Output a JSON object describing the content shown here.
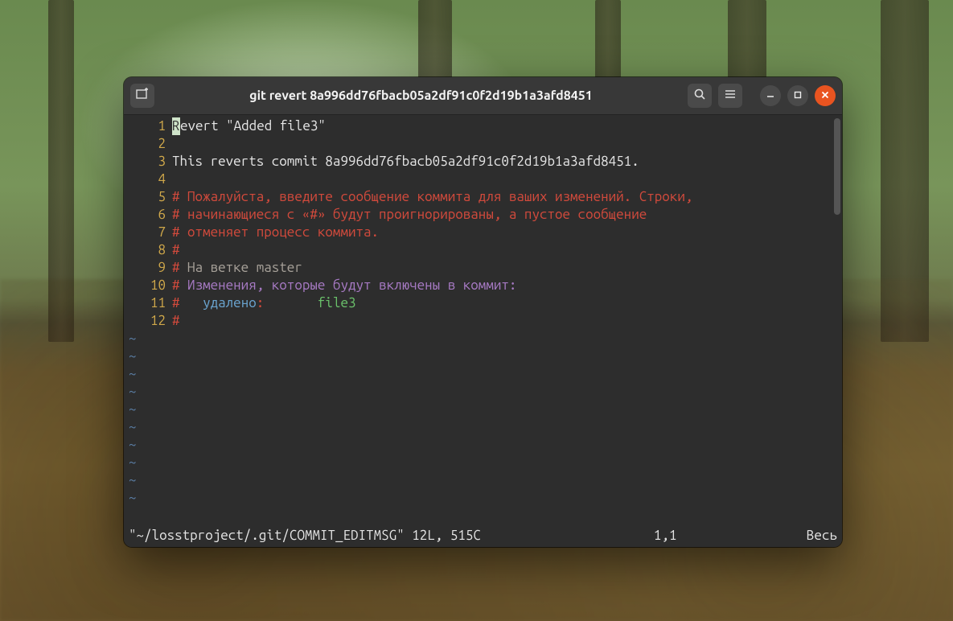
{
  "window": {
    "title": "git revert 8a996dd76fbacb05a2df91c0f2d19b1a3afd8451"
  },
  "icons": {
    "newtab": "new-tab",
    "search": "search",
    "menu": "menu",
    "minimize": "minimize",
    "maximize": "maximize",
    "close": "close"
  },
  "editor": {
    "line_count": 12,
    "cursor_line": 1,
    "cursor_col": 1,
    "lines": {
      "l1_char1": "R",
      "l1_rest": "evert \"Added file3\"",
      "l2": "",
      "l3": "This reverts commit 8a996dd76fbacb05a2df91c0f2d19b1a3afd8451.",
      "l4": "",
      "l5": "# Пожалуйста, введите сообщение коммита для ваших изменений. Строки,",
      "l6": "# начинающиеся с «#» будут проигнорированы, а пустое сообщение",
      "l7": "# отменяет процесс коммита.",
      "l8": "#",
      "l9_hash": "# ",
      "l9_rest": "На ветке master",
      "l10_hash": "# ",
      "l10_rest": "Изменения, которые будут включены в коммит:",
      "l11_hash": "#   ",
      "l11_deleted": "удалено",
      "l11_colon": ":       ",
      "l11_file": "file3",
      "l12": "#"
    },
    "tildes": 10
  },
  "status": {
    "file": "\"~/losstproject/.git/COMMIT_EDITMSG\" 12L, 515C",
    "position": "1,1",
    "percent": "Весь"
  }
}
